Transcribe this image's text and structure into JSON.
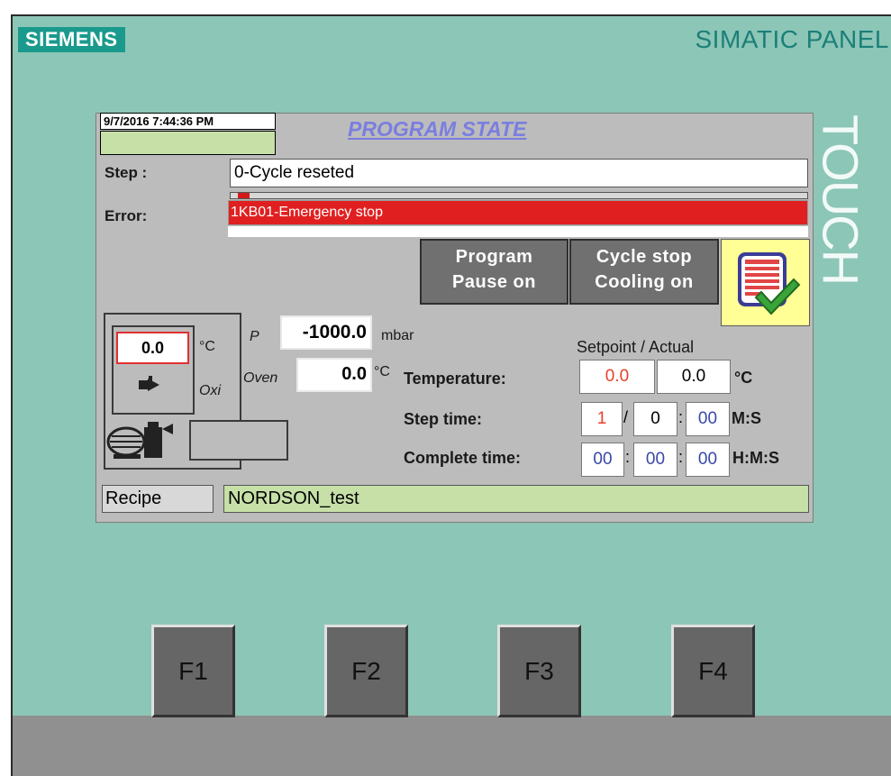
{
  "bezel": {
    "brand": "SIEMENS",
    "model": "SIMATIC PANEL",
    "touch_label": "TOUCH"
  },
  "screen": {
    "datetime": "9/7/2016 7:44:36 PM",
    "title": "PROGRAM STATE",
    "step_label": "Step :",
    "step_value": "0-Cycle reseted",
    "step_progress_fraction": 0.02,
    "error_label": "Error:",
    "error_value": "1KB01-Emergency stop",
    "buttons": {
      "program_pause": [
        "Program",
        "Pause on"
      ],
      "cycle_stop": [
        "Cycle stop",
        "Cooling on"
      ],
      "recipe_icon": "recipe-check-icon"
    },
    "machine": {
      "oxygen_value": "0.0",
      "oxygen_unit": "°C",
      "oxi_label": "Oxi",
      "pressure_label": "P",
      "pressure_value": "-1000.0",
      "pressure_unit": "mbar",
      "oven_label": "Oven",
      "oven_value": "0.0",
      "oven_unit": "°C"
    },
    "setpoint_header": "Setpoint / Actual",
    "temperature": {
      "label": "Temperature:",
      "setpoint": "0.0",
      "actual": "0.0",
      "unit": "°C"
    },
    "step_time": {
      "label": "Step time:",
      "setpoint": "1",
      "minutes": "0",
      "seconds": "00",
      "unit": "M:S"
    },
    "complete_time": {
      "label": "Complete time:",
      "hours": "00",
      "minutes": "00",
      "seconds": "00",
      "unit": "H:M:S"
    },
    "recipe_label": "Recipe",
    "recipe_name": "NORDSON_test"
  },
  "function_keys": [
    "F1",
    "F2",
    "F3",
    "F4"
  ],
  "colors": {
    "bezel_face": "#8cc6b6",
    "brand_badge": "#1a9a8c",
    "screen_bg": "#bcbcbc",
    "error_red": "#e02020",
    "recipe_green": "#c6e0a8",
    "title_blue": "#7a7ee0"
  }
}
